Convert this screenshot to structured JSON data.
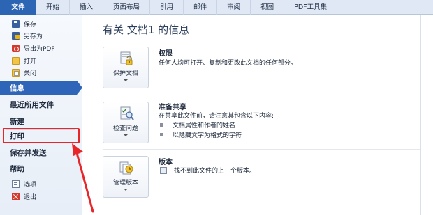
{
  "ribbon": {
    "tabs": [
      "文件",
      "开始",
      "插入",
      "页面布局",
      "引用",
      "邮件",
      "审阅",
      "视图",
      "PDF工具集"
    ]
  },
  "backstage": {
    "commands_top": [
      {
        "label": "保存",
        "icon": "save-icon"
      },
      {
        "label": "另存为",
        "icon": "save-as-icon"
      },
      {
        "label": "导出为PDF",
        "icon": "pdf-icon"
      },
      {
        "label": "打开",
        "icon": "open-folder-icon"
      },
      {
        "label": "关闭",
        "icon": "close-document-icon"
      }
    ],
    "nav": [
      "信息",
      "最近所用文件",
      "新建",
      "打印",
      "保存并发送",
      "帮助"
    ],
    "active_nav": "信息",
    "highlighted_nav": "打印",
    "commands_bottom": [
      {
        "label": "选项",
        "icon": "options-icon"
      },
      {
        "label": "退出",
        "icon": "exit-icon"
      }
    ]
  },
  "info": {
    "title": "有关 文档1 的信息",
    "sections": [
      {
        "button_label": "保护文档",
        "button_icon": "lock-key-icon",
        "heading": "权限",
        "lines": [
          "任何人均可打开、复制和更改此文档的任何部分。"
        ]
      },
      {
        "button_label": "检查问题",
        "button_icon": "inspect-document-icon",
        "heading": "准备共享",
        "lines": [
          "在共享此文件前，请注意其包含以下内容:"
        ],
        "bullets": [
          "文档属性和作者的姓名",
          "以隐藏文字为格式的字符"
        ]
      },
      {
        "button_label": "管理版本",
        "button_icon": "versions-icon",
        "heading": "版本",
        "version_line": "找不到此文件的上一个版本。"
      }
    ]
  },
  "colors": {
    "file_tab": "#2d65b5",
    "active_nav": "#2e65b8",
    "highlight": "#e8262a"
  }
}
